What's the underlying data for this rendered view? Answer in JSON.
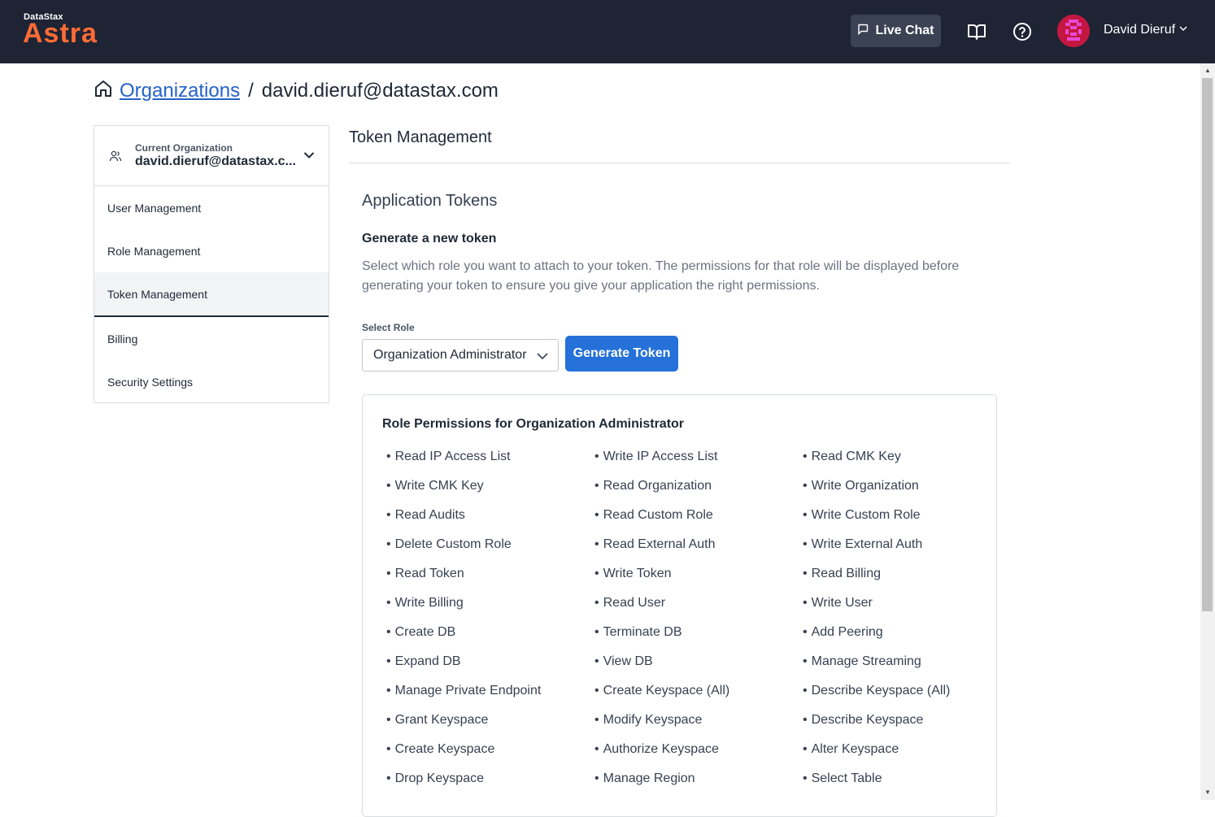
{
  "header": {
    "logo_small": "DataStax",
    "logo_big": "Astra",
    "live_chat": "Live Chat",
    "user_name": "David Dieruf",
    "accent": "#ff6b35"
  },
  "breadcrumb": {
    "link": "Organizations",
    "separator": "/",
    "current": "david.dieruf@datastax.com"
  },
  "sidebar": {
    "org_label": "Current Organization",
    "org_value": "david.dieruf@datastax.c...",
    "items": [
      {
        "label": "User Management"
      },
      {
        "label": "Role Management"
      },
      {
        "label": "Token Management"
      },
      {
        "label": "Billing"
      },
      {
        "label": "Security Settings"
      }
    ]
  },
  "main": {
    "title": "Token Management",
    "section_title": "Application Tokens",
    "subhead": "Generate a new token",
    "description": "Select which role you want to attach to your token. The permissions for that role will be displayed before generating your token to ensure you give your application the right permissions.",
    "select_label": "Select Role",
    "selected_role": "Organization Administrator",
    "generate_button": "Generate Token",
    "permissions_title": "Role Permissions for Organization Administrator",
    "permissions": [
      "Read IP Access List",
      "Write IP Access List",
      "Read CMK Key",
      "Write CMK Key",
      "Read Organization",
      "Write Organization",
      "Read Audits",
      "Read Custom Role",
      "Write Custom Role",
      "Delete Custom Role",
      "Read External Auth",
      "Write External Auth",
      "Read Token",
      "Write Token",
      "Read Billing",
      "Write Billing",
      "Read User",
      "Write User",
      "Create DB",
      "Terminate DB",
      "Add Peering",
      "Expand DB",
      "View DB",
      "Manage Streaming",
      "Manage Private Endpoint",
      "Create Keyspace (All)",
      "Describe Keyspace (All)",
      "Grant Keyspace",
      "Modify Keyspace",
      "Describe Keyspace",
      "Create Keyspace",
      "Authorize Keyspace",
      "Alter Keyspace",
      "Drop Keyspace",
      "Manage Region",
      "Select Table"
    ]
  }
}
